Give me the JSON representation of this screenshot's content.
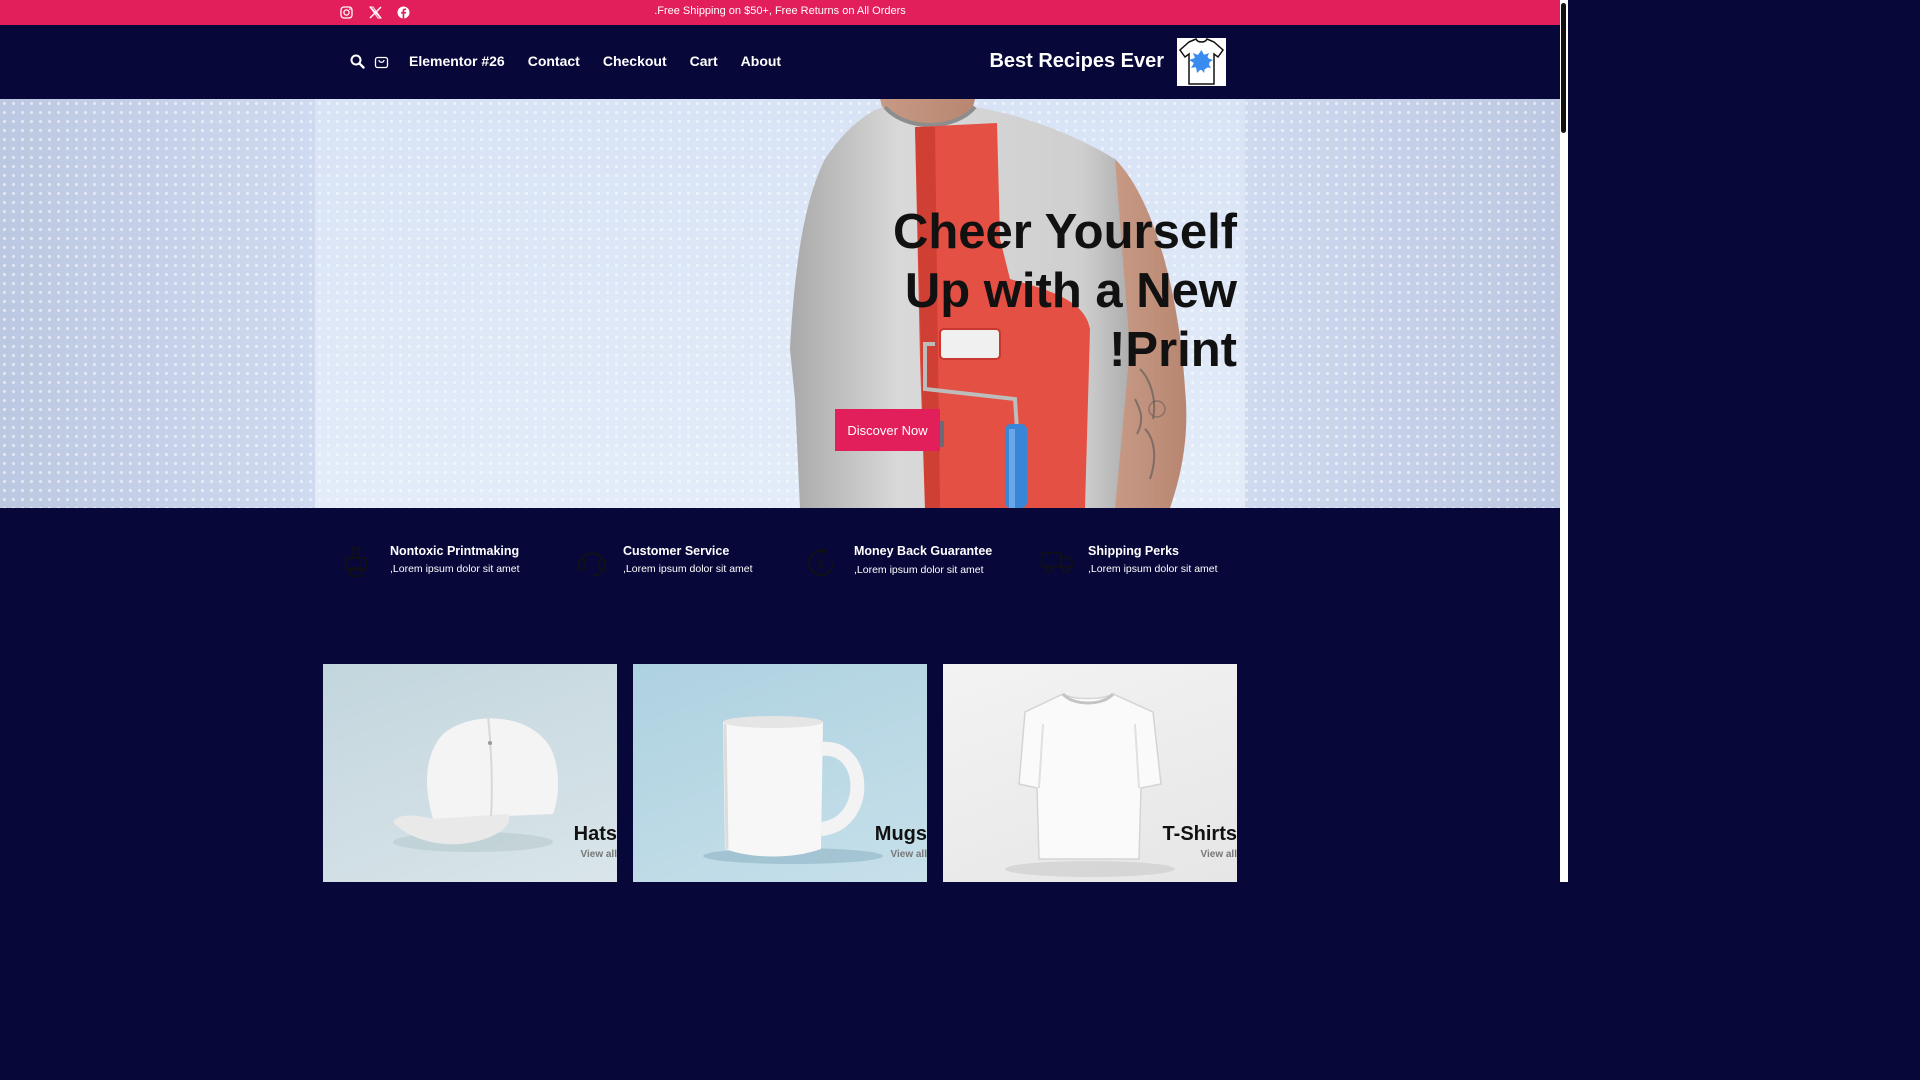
{
  "topbar": {
    "social": [
      "instagram-icon",
      "x-twitter-icon",
      "facebook-icon"
    ],
    "announcement": ".Free Shipping on $50+, Free Returns on All Orders",
    "color": "#e21e5b"
  },
  "header": {
    "icons": [
      "search-icon",
      "shopping-bag-icon"
    ],
    "nav": [
      "Elementor #26",
      "Contact",
      "Checkout",
      "Cart",
      "About"
    ],
    "brand": "Best Recipes Ever",
    "background": "#07073a"
  },
  "hero": {
    "title_lines": [
      "Cheer Yourself",
      "Up with a New",
      "!Print"
    ],
    "cta": "Discover Now"
  },
  "features": [
    {
      "icon": "printer-icon",
      "title": "Nontoxic Printmaking",
      "desc": ",Lorem ipsum dolor sit amet"
    },
    {
      "icon": "headset-icon",
      "title": "Customer Service",
      "desc": ",Lorem ipsum dolor sit amet"
    },
    {
      "icon": "money-back-icon",
      "title": "Money Back Guarantee",
      "desc": ",Lorem ipsum dolor sit amet"
    },
    {
      "icon": "truck-icon",
      "title": "Shipping Perks",
      "desc": ",Lorem ipsum dolor sit amet"
    }
  ],
  "categories": [
    {
      "title": "Hats",
      "link": "View all"
    },
    {
      "title": "Mugs",
      "link": "View all"
    },
    {
      "title": "T-Shirts",
      "link": "View all"
    }
  ]
}
